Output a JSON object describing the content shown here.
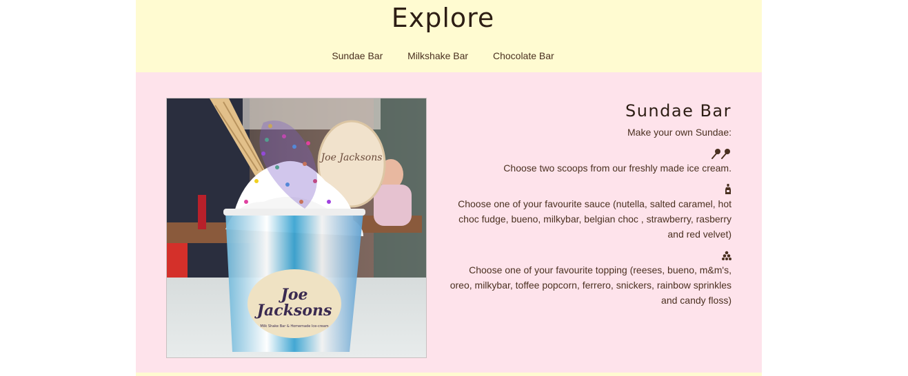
{
  "header": {
    "title": "Explore",
    "nav": [
      "Sundae Bar",
      "Milkshake Bar",
      "Chocolate Bar"
    ]
  },
  "section": {
    "title": "Sundae Bar",
    "subtitle": "Make your own Sundae:",
    "photo": {
      "icon": "sundae-photo",
      "cup_logo_line1": "Joe",
      "cup_logo_line2": "Jacksons",
      "cup_logo_tagline": "Milk Shake Bar & Homemade Ice-cream",
      "wafer_logo": "Joe Jacksons"
    },
    "steps": [
      {
        "icon": "ice-cream-scoops-icon",
        "text": "Choose two scoops from our freshly made ice cream."
      },
      {
        "icon": "sauce-bottle-icon",
        "text": "Choose one of your favourite sauce (nutella, salted caramel, hot choc fudge, bueno, milkybar, belgian choc , strawberry, rasberry and red velvet)"
      },
      {
        "icon": "topping-pile-icon",
        "text": "Choose one of your favourite topping (reeses, bueno, m&m's, oreo, milkybar, toffee popcorn, ferrero, snickers, rainbow sprinkles and candy floss)"
      }
    ]
  },
  "colors": {
    "header_bg": "#fffbd1",
    "content_bg": "#fee3eb",
    "text": "#4a3020",
    "title": "#2d1e14"
  }
}
